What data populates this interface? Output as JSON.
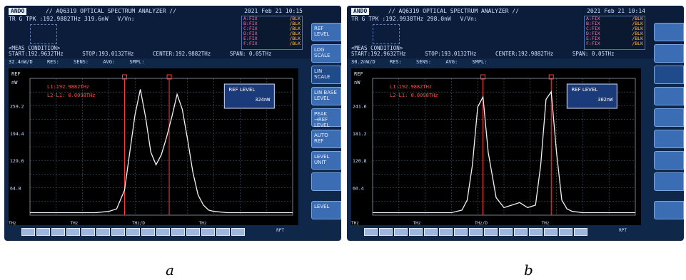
{
  "panels": [
    {
      "id": "a",
      "header": {
        "logo": "ANDO",
        "title": "// AQ6319 OPTICAL SPECTRUM ANALYZER //",
        "datetime": "2021 Feb 21 10:15",
        "trace_info": [
          "TR G TPK :192.9882THz 319.6nW",
          "V/Vn:"
        ],
        "status_rows": [
          [
            "A:FIX",
            "/BLK"
          ],
          [
            "B:FIX",
            "/BLK"
          ],
          [
            "C:FIX",
            "/BLK"
          ],
          [
            "D:FIX",
            "/BLK"
          ],
          [
            "E:FIX",
            "/BLK"
          ],
          [
            "F:FIX",
            "/BLK"
          ]
        ],
        "meas_title": "<MEAS CONDITION>",
        "start": "START:192.9632THz",
        "stop": "STOP:193.0132THz",
        "center": "CENTER:192.9882THz",
        "span": "SPAN: 0.05THz"
      },
      "vrow": {
        "scale": "32.4nW/D",
        "res": "RES:",
        "sens": "SENS:",
        "avg": "AVG:",
        "smpl": "SMPL:"
      },
      "screen": {
        "ref_label": "REF",
        "unit": "nW",
        "marker_text": [
          "L1:192.9882THz",
          "L2-L1: 0.0098THz"
        ],
        "ref_box_title": "REF LEVEL",
        "ref_box_value": "324nW",
        "y_ticks": [
          "259.2",
          "194.4",
          "129.6",
          "64.8"
        ]
      },
      "softkeys": [
        "REF LEVEL",
        "LOG SCALE",
        "LIN SCALE",
        "LIN BASE LEVEL",
        "PEAK →REF LEVEL",
        "AUTO REF",
        "LEVEL UNIT",
        "",
        "LEVEL"
      ],
      "bottom_units": [
        "THz",
        "THz",
        "THz/D",
        "THz"
      ],
      "rpt": "RPT",
      "caption": "a",
      "chart_data": {
        "type": "line",
        "x": [
          0.0,
          0.05,
          0.1,
          0.15,
          0.2,
          0.25,
          0.3,
          0.33,
          0.36,
          0.38,
          0.4,
          0.42,
          0.44,
          0.46,
          0.48,
          0.5,
          0.52,
          0.54,
          0.56,
          0.58,
          0.6,
          0.62,
          0.64,
          0.66,
          0.68,
          0.7,
          0.75,
          0.8,
          0.85,
          0.9,
          1.0
        ],
        "y": [
          0.02,
          0.02,
          0.02,
          0.02,
          0.02,
          0.02,
          0.03,
          0.05,
          0.2,
          0.5,
          0.8,
          1.0,
          0.78,
          0.5,
          0.4,
          0.48,
          0.62,
          0.78,
          0.96,
          0.84,
          0.6,
          0.34,
          0.16,
          0.08,
          0.04,
          0.03,
          0.02,
          0.02,
          0.02,
          0.02,
          0.02
        ],
        "markers_x": [
          0.36,
          0.53
        ]
      }
    },
    {
      "id": "b",
      "header": {
        "logo": "ANDO",
        "title": "// AQ6319 OPTICAL SPECTRUM ANALYZER //",
        "datetime": "2021 Feb 21 10:14",
        "trace_info": [
          "TR G TPK :192.9938THz 298.0nW",
          "V/Vn:"
        ],
        "status_rows": [
          [
            "A:FIX",
            "/BLK"
          ],
          [
            "B:FIX",
            "/BLK"
          ],
          [
            "C:FIX",
            "/BLK"
          ],
          [
            "D:FIX",
            "/BLK"
          ],
          [
            "E:FIX",
            "/BLK"
          ],
          [
            "F:FIX",
            "/BLK"
          ]
        ],
        "meas_title": "<MEAS CONDITION>",
        "start": "START:192.9632THz",
        "stop": "STOP:193.0132THz",
        "center": "CENTER:192.9882THz",
        "span": "SPAN: 0.05THz"
      },
      "vrow": {
        "scale": "30.2nW/D",
        "res": "RES:",
        "sens": "SENS:",
        "avg": "AVG:",
        "smpl": "SMPL:"
      },
      "screen": {
        "ref_label": "REF",
        "unit": "nW",
        "marker_text": [
          "L1:192.9882THz",
          "L2-L1: 0.0098THz"
        ],
        "ref_box_title": "REF LEVEL",
        "ref_box_value": "302nW",
        "y_ticks": [
          "241.6",
          "181.2",
          "120.8",
          "60.4"
        ]
      },
      "softkeys": [
        "",
        "",
        "",
        "",
        "",
        "",
        "",
        "",
        ""
      ],
      "bottom_units": [
        "THz",
        "THz",
        "THz/D",
        "THz"
      ],
      "rpt": "RPT",
      "caption": "b",
      "chart_data": {
        "type": "line",
        "x": [
          0.0,
          0.05,
          0.1,
          0.15,
          0.2,
          0.25,
          0.3,
          0.34,
          0.36,
          0.38,
          0.4,
          0.42,
          0.44,
          0.47,
          0.5,
          0.53,
          0.56,
          0.59,
          0.62,
          0.64,
          0.66,
          0.68,
          0.7,
          0.72,
          0.74,
          0.76,
          0.8,
          0.85,
          0.9,
          0.95,
          1.0
        ],
        "y": [
          0.02,
          0.02,
          0.02,
          0.02,
          0.02,
          0.02,
          0.02,
          0.04,
          0.12,
          0.4,
          0.86,
          0.94,
          0.5,
          0.14,
          0.06,
          0.08,
          0.1,
          0.06,
          0.08,
          0.4,
          0.92,
          0.98,
          0.5,
          0.12,
          0.05,
          0.03,
          0.02,
          0.02,
          0.02,
          0.02,
          0.02
        ],
        "markers_x": [
          0.42,
          0.68
        ]
      }
    }
  ]
}
